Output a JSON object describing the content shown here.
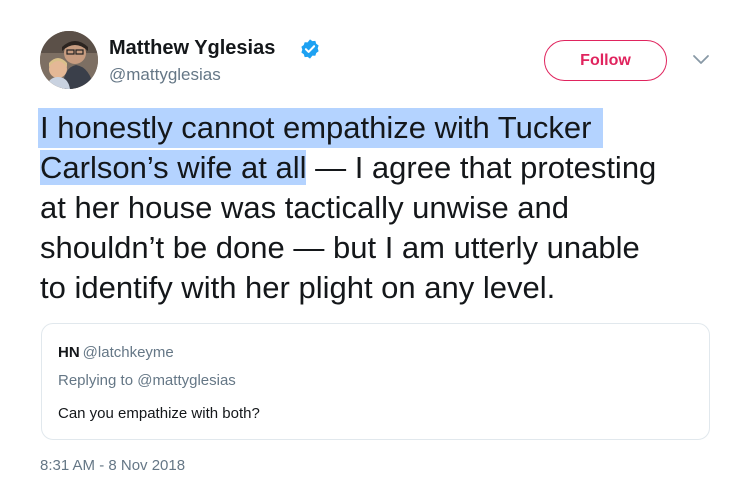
{
  "author": {
    "name": "Matthew Yglesias",
    "handle": "@mattyglesias",
    "verified": true,
    "avatar_icon": "user-avatar-photo"
  },
  "actions": {
    "follow_label": "Follow",
    "menu_icon": "chevron-down-icon"
  },
  "tweet": {
    "lines": [
      "I honestly cannot empathize with Tucker",
      "Carlson’s wife at all",
      " — I agree that protesting",
      "at her house was tactically unwise and",
      "shouldn’t be done — but I am utterly unable",
      "to identify with her plight on any level."
    ],
    "highlighted_text": "I honestly cannot empathize with Tucker Carlson’s wife at all"
  },
  "quoted_tweet": {
    "name": "HN",
    "handle": "@latchkeyme",
    "reply_context": "Replying to @mattyglesias",
    "text": "Can you empathize with both?"
  },
  "timestamp": "8:31 AM - 8 Nov 2018",
  "colors": {
    "follow_accent": "#e0245e",
    "verified_badge": "#1da1f2",
    "selection_highlight": "#b4d3ff",
    "secondary_text": "#657786",
    "primary_text": "#14171a"
  }
}
